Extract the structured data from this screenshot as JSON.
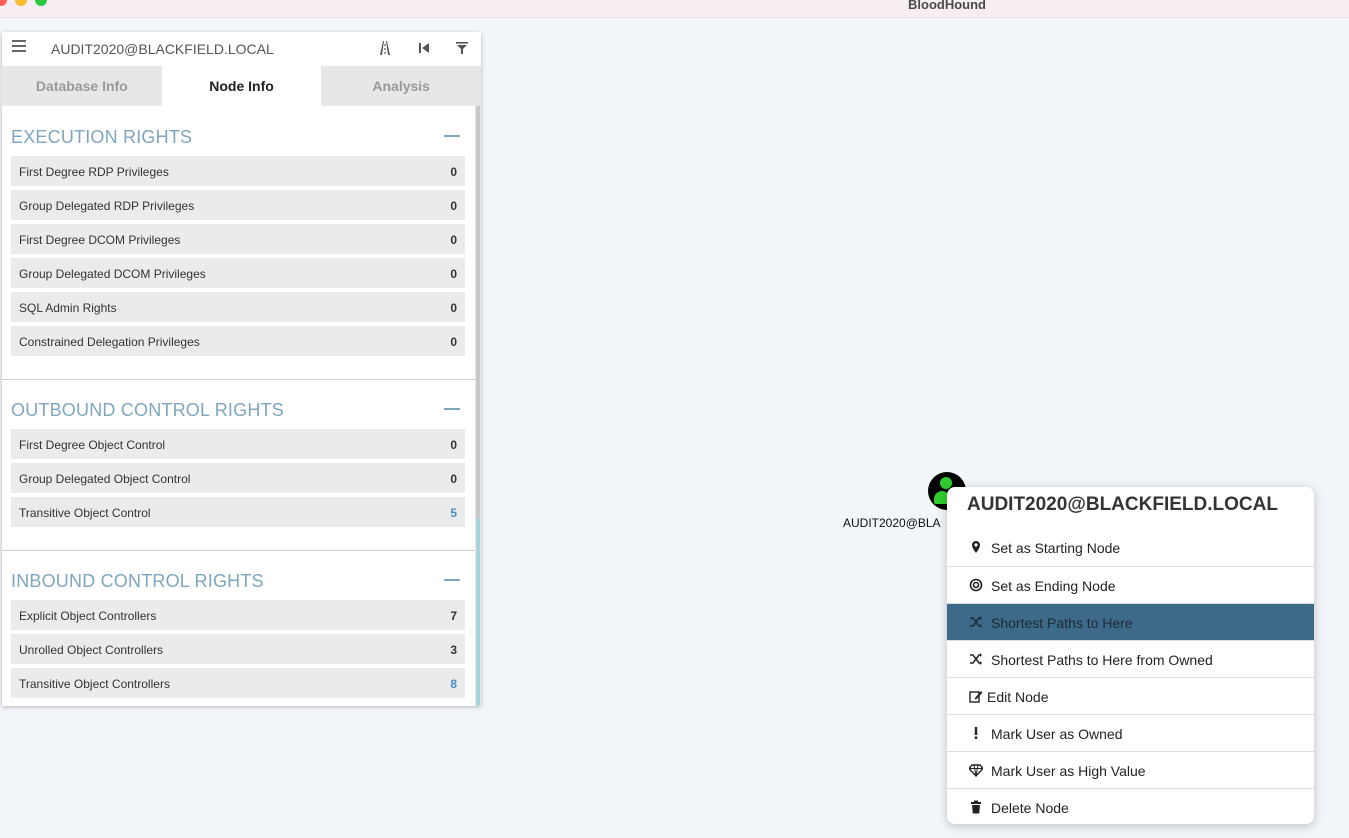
{
  "window": {
    "title": "BloodHound"
  },
  "search": {
    "value": "AUDIT2020@BLACKFIELD.LOCAL"
  },
  "tabs": [
    {
      "label": "Database Info"
    },
    {
      "label": "Node Info"
    },
    {
      "label": "Analysis"
    }
  ],
  "sections": {
    "execution": {
      "title": "EXECUTION RIGHTS",
      "rows": [
        {
          "label": "First Degree RDP Privileges",
          "count": "0"
        },
        {
          "label": "Group Delegated RDP Privileges",
          "count": "0"
        },
        {
          "label": "First Degree DCOM Privileges",
          "count": "0"
        },
        {
          "label": "Group Delegated DCOM Privileges",
          "count": "0"
        },
        {
          "label": "SQL Admin Rights",
          "count": "0"
        },
        {
          "label": "Constrained Delegation Privileges",
          "count": "0"
        }
      ]
    },
    "outbound": {
      "title": "OUTBOUND CONTROL RIGHTS",
      "rows": [
        {
          "label": "First Degree Object Control",
          "count": "0"
        },
        {
          "label": "Group Delegated Object Control",
          "count": "0"
        },
        {
          "label": "Transitive Object Control",
          "count": "5"
        }
      ]
    },
    "inbound": {
      "title": "INBOUND CONTROL RIGHTS",
      "rows": [
        {
          "label": "Explicit Object Controllers",
          "count": "7"
        },
        {
          "label": "Unrolled Object Controllers",
          "count": "3"
        },
        {
          "label": "Transitive Object Controllers",
          "count": "8"
        }
      ]
    }
  },
  "graph": {
    "node_label": "AUDIT2020@BLA",
    "node_color": "#2ecc2e"
  },
  "context_menu": {
    "title": "AUDIT2020@BLACKFIELD.LOCAL",
    "items": [
      {
        "label": "Set as Starting Node",
        "icon": "map-pin-icon"
      },
      {
        "label": "Set as Ending Node",
        "icon": "target-icon"
      },
      {
        "label": "Shortest Paths to Here",
        "icon": "shuffle-icon"
      },
      {
        "label": "Shortest Paths to Here from Owned",
        "icon": "shuffle-icon"
      },
      {
        "label": "Edit Node",
        "icon": "edit-icon"
      },
      {
        "label": "Mark User as Owned",
        "icon": "exclamation-icon"
      },
      {
        "label": "Mark User as High Value",
        "icon": "diamond-icon"
      },
      {
        "label": "Delete Node",
        "icon": "trash-icon"
      }
    ]
  },
  "colors": {
    "accent": "#7ea7bd",
    "highlight": "#3e6a8a",
    "link": "#4a8ec2"
  }
}
